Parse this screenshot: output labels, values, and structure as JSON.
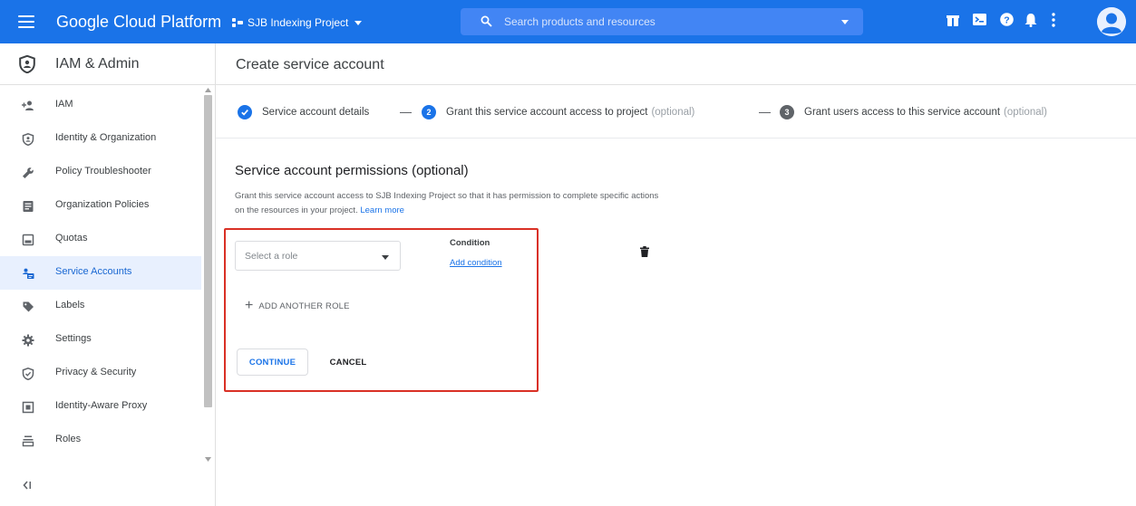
{
  "topbar": {
    "brand": "Google Cloud Platform",
    "project": "SJB Indexing Project",
    "search_placeholder": "Search products and resources",
    "color": "#1a73e8"
  },
  "sidebar": {
    "title": "IAM & Admin",
    "items": [
      {
        "label": "IAM",
        "icon": "person-add-icon"
      },
      {
        "label": "Identity & Organization",
        "icon": "shield-person-icon"
      },
      {
        "label": "Policy Troubleshooter",
        "icon": "wrench-icon"
      },
      {
        "label": "Organization Policies",
        "icon": "document-list-icon"
      },
      {
        "label": "Quotas",
        "icon": "quota-icon"
      },
      {
        "label": "Service Accounts",
        "icon": "service-account-icon",
        "active": true
      },
      {
        "label": "Labels",
        "icon": "label-icon"
      },
      {
        "label": "Settings",
        "icon": "gear-icon"
      },
      {
        "label": "Privacy & Security",
        "icon": "shield-icon"
      },
      {
        "label": "Identity-Aware Proxy",
        "icon": "proxy-icon"
      },
      {
        "label": "Roles",
        "icon": "roles-icon"
      }
    ]
  },
  "page": {
    "title": "Create service account"
  },
  "stepper": {
    "step1": {
      "label": "Service account details"
    },
    "step2": {
      "number": "2",
      "label": "Grant this service account access to project",
      "optional": "(optional)"
    },
    "step3": {
      "number": "3",
      "label": "Grant users access to this service account",
      "optional": "(optional)"
    }
  },
  "permissions": {
    "heading": "Service account permissions (optional)",
    "description": "Grant this service account access to SJB Indexing Project so that it has permission to complete specific actions on the resources in your project.",
    "learn_more": "Learn more",
    "role_placeholder": "Select a role",
    "condition_label": "Condition",
    "add_condition": "Add condition",
    "add_another_role": "ADD ANOTHER ROLE",
    "continue": "CONTINUE",
    "cancel": "CANCEL"
  }
}
